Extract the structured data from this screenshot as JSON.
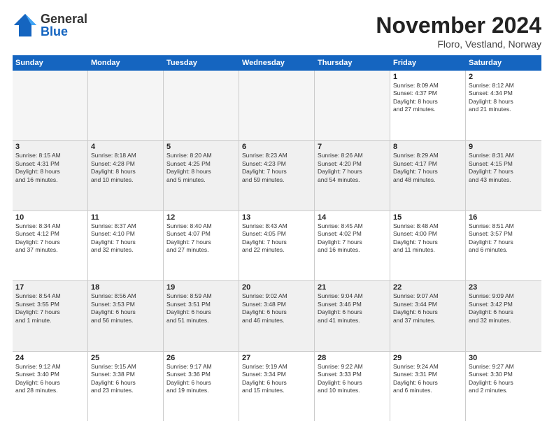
{
  "logo": {
    "general": "General",
    "blue": "Blue"
  },
  "title": "November 2024",
  "location": "Floro, Vestland, Norway",
  "days_of_week": [
    "Sunday",
    "Monday",
    "Tuesday",
    "Wednesday",
    "Thursday",
    "Friday",
    "Saturday"
  ],
  "weeks": [
    [
      {
        "day": "",
        "info": "",
        "empty": true
      },
      {
        "day": "",
        "info": "",
        "empty": true
      },
      {
        "day": "",
        "info": "",
        "empty": true
      },
      {
        "day": "",
        "info": "",
        "empty": true
      },
      {
        "day": "",
        "info": "",
        "empty": true
      },
      {
        "day": "1",
        "info": "Sunrise: 8:09 AM\nSunset: 4:37 PM\nDaylight: 8 hours\nand 27 minutes."
      },
      {
        "day": "2",
        "info": "Sunrise: 8:12 AM\nSunset: 4:34 PM\nDaylight: 8 hours\nand 21 minutes."
      }
    ],
    [
      {
        "day": "3",
        "info": "Sunrise: 8:15 AM\nSunset: 4:31 PM\nDaylight: 8 hours\nand 16 minutes."
      },
      {
        "day": "4",
        "info": "Sunrise: 8:18 AM\nSunset: 4:28 PM\nDaylight: 8 hours\nand 10 minutes."
      },
      {
        "day": "5",
        "info": "Sunrise: 8:20 AM\nSunset: 4:25 PM\nDaylight: 8 hours\nand 5 minutes."
      },
      {
        "day": "6",
        "info": "Sunrise: 8:23 AM\nSunset: 4:23 PM\nDaylight: 7 hours\nand 59 minutes."
      },
      {
        "day": "7",
        "info": "Sunrise: 8:26 AM\nSunset: 4:20 PM\nDaylight: 7 hours\nand 54 minutes."
      },
      {
        "day": "8",
        "info": "Sunrise: 8:29 AM\nSunset: 4:17 PM\nDaylight: 7 hours\nand 48 minutes."
      },
      {
        "day": "9",
        "info": "Sunrise: 8:31 AM\nSunset: 4:15 PM\nDaylight: 7 hours\nand 43 minutes."
      }
    ],
    [
      {
        "day": "10",
        "info": "Sunrise: 8:34 AM\nSunset: 4:12 PM\nDaylight: 7 hours\nand 37 minutes."
      },
      {
        "day": "11",
        "info": "Sunrise: 8:37 AM\nSunset: 4:10 PM\nDaylight: 7 hours\nand 32 minutes."
      },
      {
        "day": "12",
        "info": "Sunrise: 8:40 AM\nSunset: 4:07 PM\nDaylight: 7 hours\nand 27 minutes."
      },
      {
        "day": "13",
        "info": "Sunrise: 8:43 AM\nSunset: 4:05 PM\nDaylight: 7 hours\nand 22 minutes."
      },
      {
        "day": "14",
        "info": "Sunrise: 8:45 AM\nSunset: 4:02 PM\nDaylight: 7 hours\nand 16 minutes."
      },
      {
        "day": "15",
        "info": "Sunrise: 8:48 AM\nSunset: 4:00 PM\nDaylight: 7 hours\nand 11 minutes."
      },
      {
        "day": "16",
        "info": "Sunrise: 8:51 AM\nSunset: 3:57 PM\nDaylight: 7 hours\nand 6 minutes."
      }
    ],
    [
      {
        "day": "17",
        "info": "Sunrise: 8:54 AM\nSunset: 3:55 PM\nDaylight: 7 hours\nand 1 minute."
      },
      {
        "day": "18",
        "info": "Sunrise: 8:56 AM\nSunset: 3:53 PM\nDaylight: 6 hours\nand 56 minutes."
      },
      {
        "day": "19",
        "info": "Sunrise: 8:59 AM\nSunset: 3:51 PM\nDaylight: 6 hours\nand 51 minutes."
      },
      {
        "day": "20",
        "info": "Sunrise: 9:02 AM\nSunset: 3:48 PM\nDaylight: 6 hours\nand 46 minutes."
      },
      {
        "day": "21",
        "info": "Sunrise: 9:04 AM\nSunset: 3:46 PM\nDaylight: 6 hours\nand 41 minutes."
      },
      {
        "day": "22",
        "info": "Sunrise: 9:07 AM\nSunset: 3:44 PM\nDaylight: 6 hours\nand 37 minutes."
      },
      {
        "day": "23",
        "info": "Sunrise: 9:09 AM\nSunset: 3:42 PM\nDaylight: 6 hours\nand 32 minutes."
      }
    ],
    [
      {
        "day": "24",
        "info": "Sunrise: 9:12 AM\nSunset: 3:40 PM\nDaylight: 6 hours\nand 28 minutes."
      },
      {
        "day": "25",
        "info": "Sunrise: 9:15 AM\nSunset: 3:38 PM\nDaylight: 6 hours\nand 23 minutes."
      },
      {
        "day": "26",
        "info": "Sunrise: 9:17 AM\nSunset: 3:36 PM\nDaylight: 6 hours\nand 19 minutes."
      },
      {
        "day": "27",
        "info": "Sunrise: 9:19 AM\nSunset: 3:34 PM\nDaylight: 6 hours\nand 15 minutes."
      },
      {
        "day": "28",
        "info": "Sunrise: 9:22 AM\nSunset: 3:33 PM\nDaylight: 6 hours\nand 10 minutes."
      },
      {
        "day": "29",
        "info": "Sunrise: 9:24 AM\nSunset: 3:31 PM\nDaylight: 6 hours\nand 6 minutes."
      },
      {
        "day": "30",
        "info": "Sunrise: 9:27 AM\nSunset: 3:30 PM\nDaylight: 6 hours\nand 2 minutes."
      }
    ]
  ]
}
